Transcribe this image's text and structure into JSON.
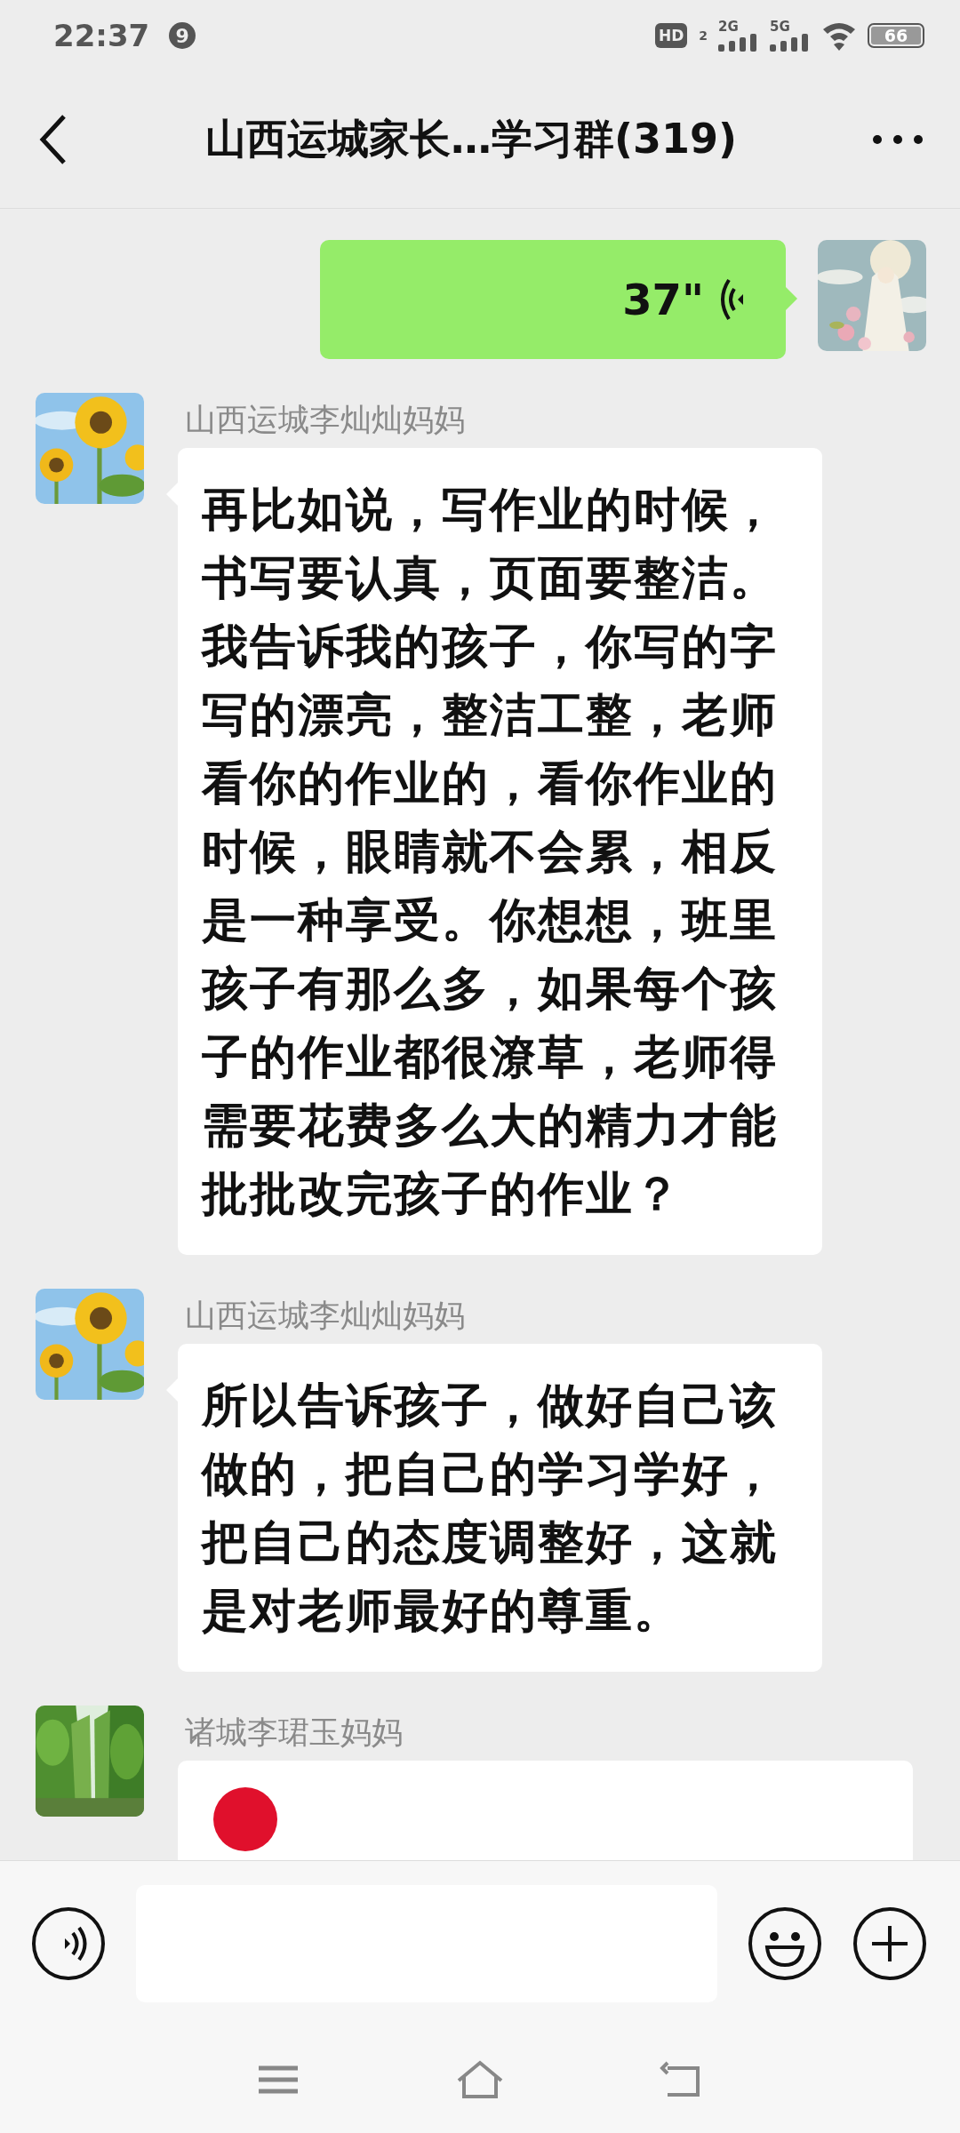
{
  "status_bar": {
    "time": "22:37",
    "notification_count": "9",
    "hd_label": "HD",
    "hd_sub": "2",
    "sim1": "2G",
    "sim2": "5G",
    "battery": "66"
  },
  "header": {
    "title": "山西运城家长…学习群(319)"
  },
  "messages": [
    {
      "kind": "voice",
      "duration": "37\""
    },
    {
      "kind": "text",
      "sender": "山西运城李灿灿妈妈",
      "text": "再比如说，写作业的时候，书写要认真，页面要整洁。我告诉我的孩子，你写的字写的漂亮，整洁工整，老师看你的作业的，看你作业的时候，眼睛就不会累，相反是一种享受。你想想，班里孩子有那么多，如果每个孩子的作业都很潦草，老师得需要花费多么大的精力才能批批改完孩子的作业？"
    },
    {
      "kind": "text",
      "sender": "山西运城李灿灿妈妈",
      "text": "所以告诉孩子，做好自己该做的，把自己的学习学好，把自己的态度调整好，这就是对老师最好的尊重。"
    },
    {
      "kind": "card",
      "sender": "诸城李珺玉妈妈"
    }
  ]
}
